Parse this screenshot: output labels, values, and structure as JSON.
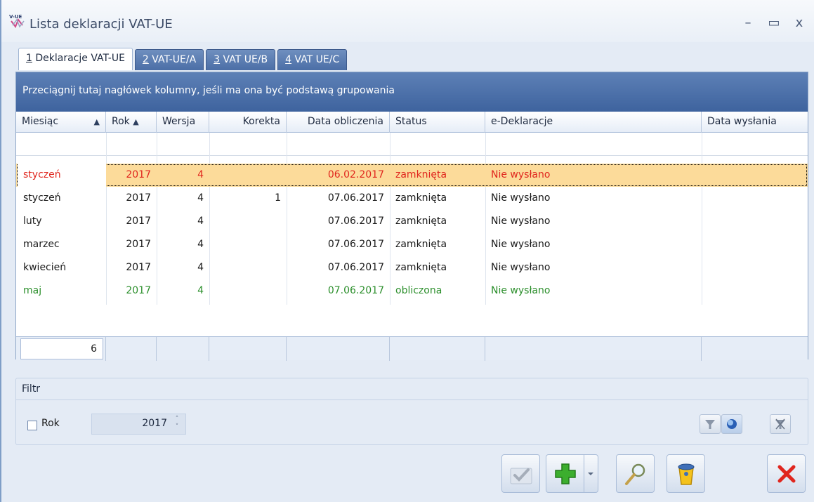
{
  "window": {
    "title": "Lista deklaracji VAT-UE",
    "icon_text": "V-UE",
    "minimize": "–",
    "maximize": "▭",
    "close": "x"
  },
  "tabs": [
    {
      "number": "1",
      "label": " Deklaracje VAT-UE"
    },
    {
      "number": "2",
      "label": " VAT-UE/A"
    },
    {
      "number": "3",
      "label": " VAT UE/B"
    },
    {
      "number": "4",
      "label": " VAT UE/C"
    }
  ],
  "grid": {
    "group_panel_text": "Przeciągnij tutaj nagłówek kolumny, jeśli ma ona być podstawą grupowania",
    "columns": [
      "Miesiąc",
      "Rok",
      "Wersja",
      "Korekta",
      "Data obliczenia",
      "Status",
      "e-Deklaracje",
      "Data wysłania"
    ],
    "sort_arrow": "▲",
    "rows": [
      {
        "month": "styczeń",
        "year": "2017",
        "version": "4",
        "correction": "",
        "date": "06.02.2017",
        "status": "zamknięta",
        "edecl": "Nie wysłano",
        "sent": "",
        "color": "#e0261e"
      },
      {
        "month": "styczeń",
        "year": "2017",
        "version": "4",
        "correction": "1",
        "date": "07.06.2017",
        "status": "zamknięta",
        "edecl": "Nie wysłano",
        "sent": "",
        "color": "#1a1a1a"
      },
      {
        "month": "luty",
        "year": "2017",
        "version": "4",
        "correction": "",
        "date": "07.06.2017",
        "status": "zamknięta",
        "edecl": "Nie wysłano",
        "sent": "",
        "color": "#1a1a1a"
      },
      {
        "month": "marzec",
        "year": "2017",
        "version": "4",
        "correction": "",
        "date": "07.06.2017",
        "status": "zamknięta",
        "edecl": "Nie wysłano",
        "sent": "",
        "color": "#1a1a1a"
      },
      {
        "month": "kwiecień",
        "year": "2017",
        "version": "4",
        "correction": "",
        "date": "07.06.2017",
        "status": "zamknięta",
        "edecl": "Nie wysłano",
        "sent": "",
        "color": "#1a1a1a"
      },
      {
        "month": "maj",
        "year": "2017",
        "version": "4",
        "correction": "",
        "date": "07.06.2017",
        "status": "obliczona",
        "edecl": "Nie wysłano",
        "sent": "",
        "color": "#2c8f2c"
      }
    ],
    "footer_count": "6"
  },
  "filter": {
    "title": "Filtr",
    "rok_label": "Rok",
    "rok_value": "2017",
    "spin_up": "˄",
    "spin_down": "˅"
  },
  "toolbar": {
    "buttons": [
      "accept-icon",
      "add-icon",
      "preview-icon",
      "delete-icon",
      "close-icon"
    ]
  }
}
